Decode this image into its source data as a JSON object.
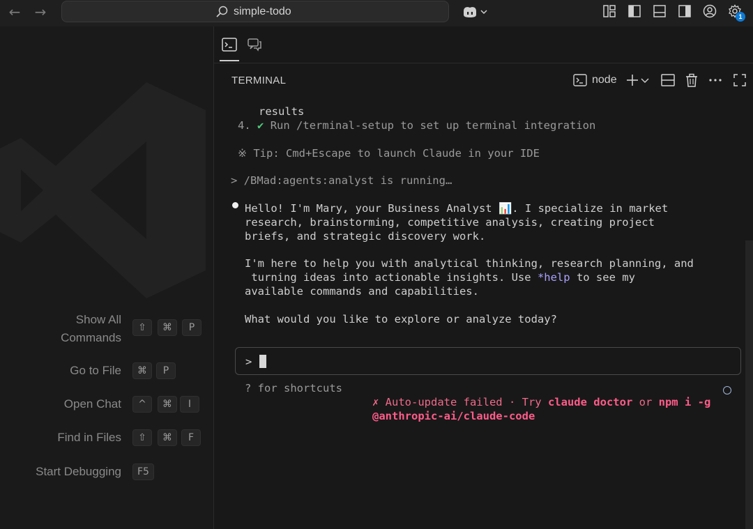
{
  "titlebar": {
    "search_text": "simple-todo",
    "badge_count": "1"
  },
  "shortcuts": [
    {
      "label": "Show All\nCommands",
      "keys": [
        "⇧",
        "⌘",
        "P"
      ]
    },
    {
      "label": "Go to File",
      "keys": [
        "⌘",
        "P"
      ]
    },
    {
      "label": "Open Chat",
      "keys": [
        "^",
        "⌘",
        "I"
      ]
    },
    {
      "label": "Find in Files",
      "keys": [
        "⇧",
        "⌘",
        "F"
      ]
    },
    {
      "label": "Start Debugging",
      "keys": [
        "F5"
      ]
    }
  ],
  "terminal": {
    "title": "TERMINAL",
    "profile": "node",
    "lines": {
      "l1": "results",
      "l2_num": "4.",
      "l2_check": "✔",
      "l2_text": "Run /terminal-setup to set up terminal integration",
      "tip": "※ Tip: Cmd+Escape to launch Claude in your IDE",
      "running": "> /BMad:agents:analyst is running…",
      "msg1": "Hello! I'm Mary, your Business Analyst 📊. I specialize in market",
      "msg2": "research, brainstorming, competitive analysis, creating project",
      "msg3": "briefs, and strategic discovery work.",
      "msg4": "I'm here to help you with analytical thinking, research planning, and",
      "msg5a": " turning ideas into actionable insights. Use ",
      "msg5b": "*help",
      "msg5c": " to see my",
      "msg6": "available commands and capabilities.",
      "msg7": "What would you like to explore or analyze today?",
      "prompt": ">",
      "shortcuts_hint": "? for shortcuts",
      "err_a": "✗ Auto-update failed · Try ",
      "err_b": "claude doctor",
      "err_c": " or ",
      "err_d": "npm i -g",
      "err_e": "@anthropic-ai/claude-code"
    }
  },
  "colors": {
    "accent_badge": "#0e7ad4",
    "success": "#4ec97a",
    "error": "#ff5c8a",
    "link": "#a9a0ff"
  }
}
